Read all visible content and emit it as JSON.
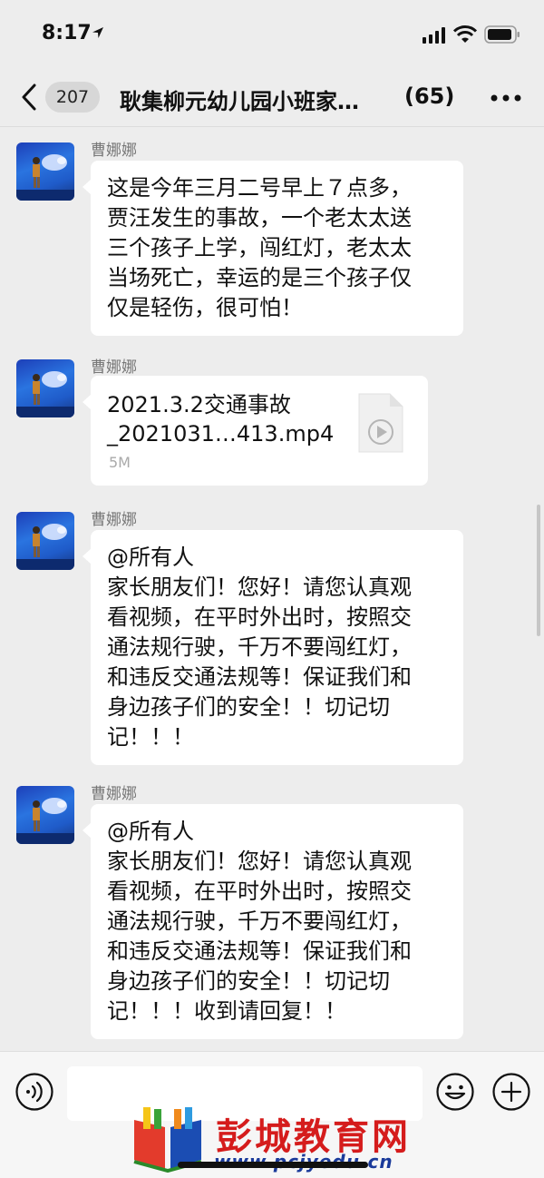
{
  "status": {
    "time": "8:17"
  },
  "nav": {
    "badge": "207",
    "title": "耿集柳元幼儿园小班家…",
    "count": "(65)"
  },
  "messages": [
    {
      "sender": "曹娜娜",
      "text": "这是今年三月二号早上７点多，\n贾汪发生的事故，一个老太太送\n三个孩子上学，闯红灯，老太太\n当场死亡，幸运的是三个孩子仅\n仅是轻伤，很可怕！"
    },
    {
      "sender": "曹娜娜",
      "file_name": "2021.3.2交通事故\n_2021031…413.mp4",
      "file_size": "5M"
    },
    {
      "sender": "曹娜娜",
      "text": "@所有人\n家长朋友们！您好！请您认真观\n看视频，在平时外出时，按照交\n通法规行驶，千万不要闯红灯，\n和违反交通法规等！保证我们和\n身边孩子们的安全！！切记切\n记！！！"
    },
    {
      "sender": "曹娜娜",
      "text": "@所有人\n家长朋友们！您好！请您认真观\n看视频，在平时外出时，按照交\n通法规行驶，千万不要闯红灯，\n和违反交通法规等！保证我们和\n身边孩子们的安全！！切记切\n记！！！收到请回复！！"
    }
  ],
  "watermark": {
    "title": "彭城教育网",
    "url": "www.pcjyedu.cn"
  },
  "icons": {
    "back": "chevron-left-icon",
    "more": "more-dots-icon",
    "voice": "voice-icon",
    "emoji": "emoji-icon",
    "plus": "plus-icon",
    "video_file": "video-file-icon"
  }
}
